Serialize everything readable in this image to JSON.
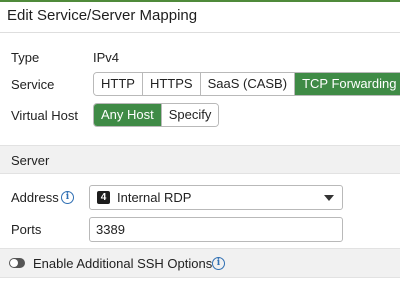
{
  "dialog": {
    "title": "Edit Service/Server Mapping"
  },
  "type": {
    "label": "Type",
    "value": "IPv4"
  },
  "service": {
    "label": "Service",
    "options": [
      "HTTP",
      "HTTPS",
      "SaaS (CASB)",
      "TCP Forwarding"
    ],
    "selected": "TCP Forwarding"
  },
  "virtual_host": {
    "label": "Virtual Host",
    "options": [
      "Any Host",
      "Specify"
    ],
    "selected": "Any Host"
  },
  "server": {
    "section_title": "Server",
    "address": {
      "label": "Address",
      "selected_value": "Internal RDP",
      "badge_icon": "address-object-icon"
    },
    "ports": {
      "label": "Ports",
      "value": "3389"
    }
  },
  "ssh": {
    "label": "Enable Additional SSH Options",
    "enabled": false
  },
  "colors": {
    "accent_green": "#3f8b46",
    "info_blue": "#2f6fb3",
    "section_band": "#f1f1f1"
  }
}
